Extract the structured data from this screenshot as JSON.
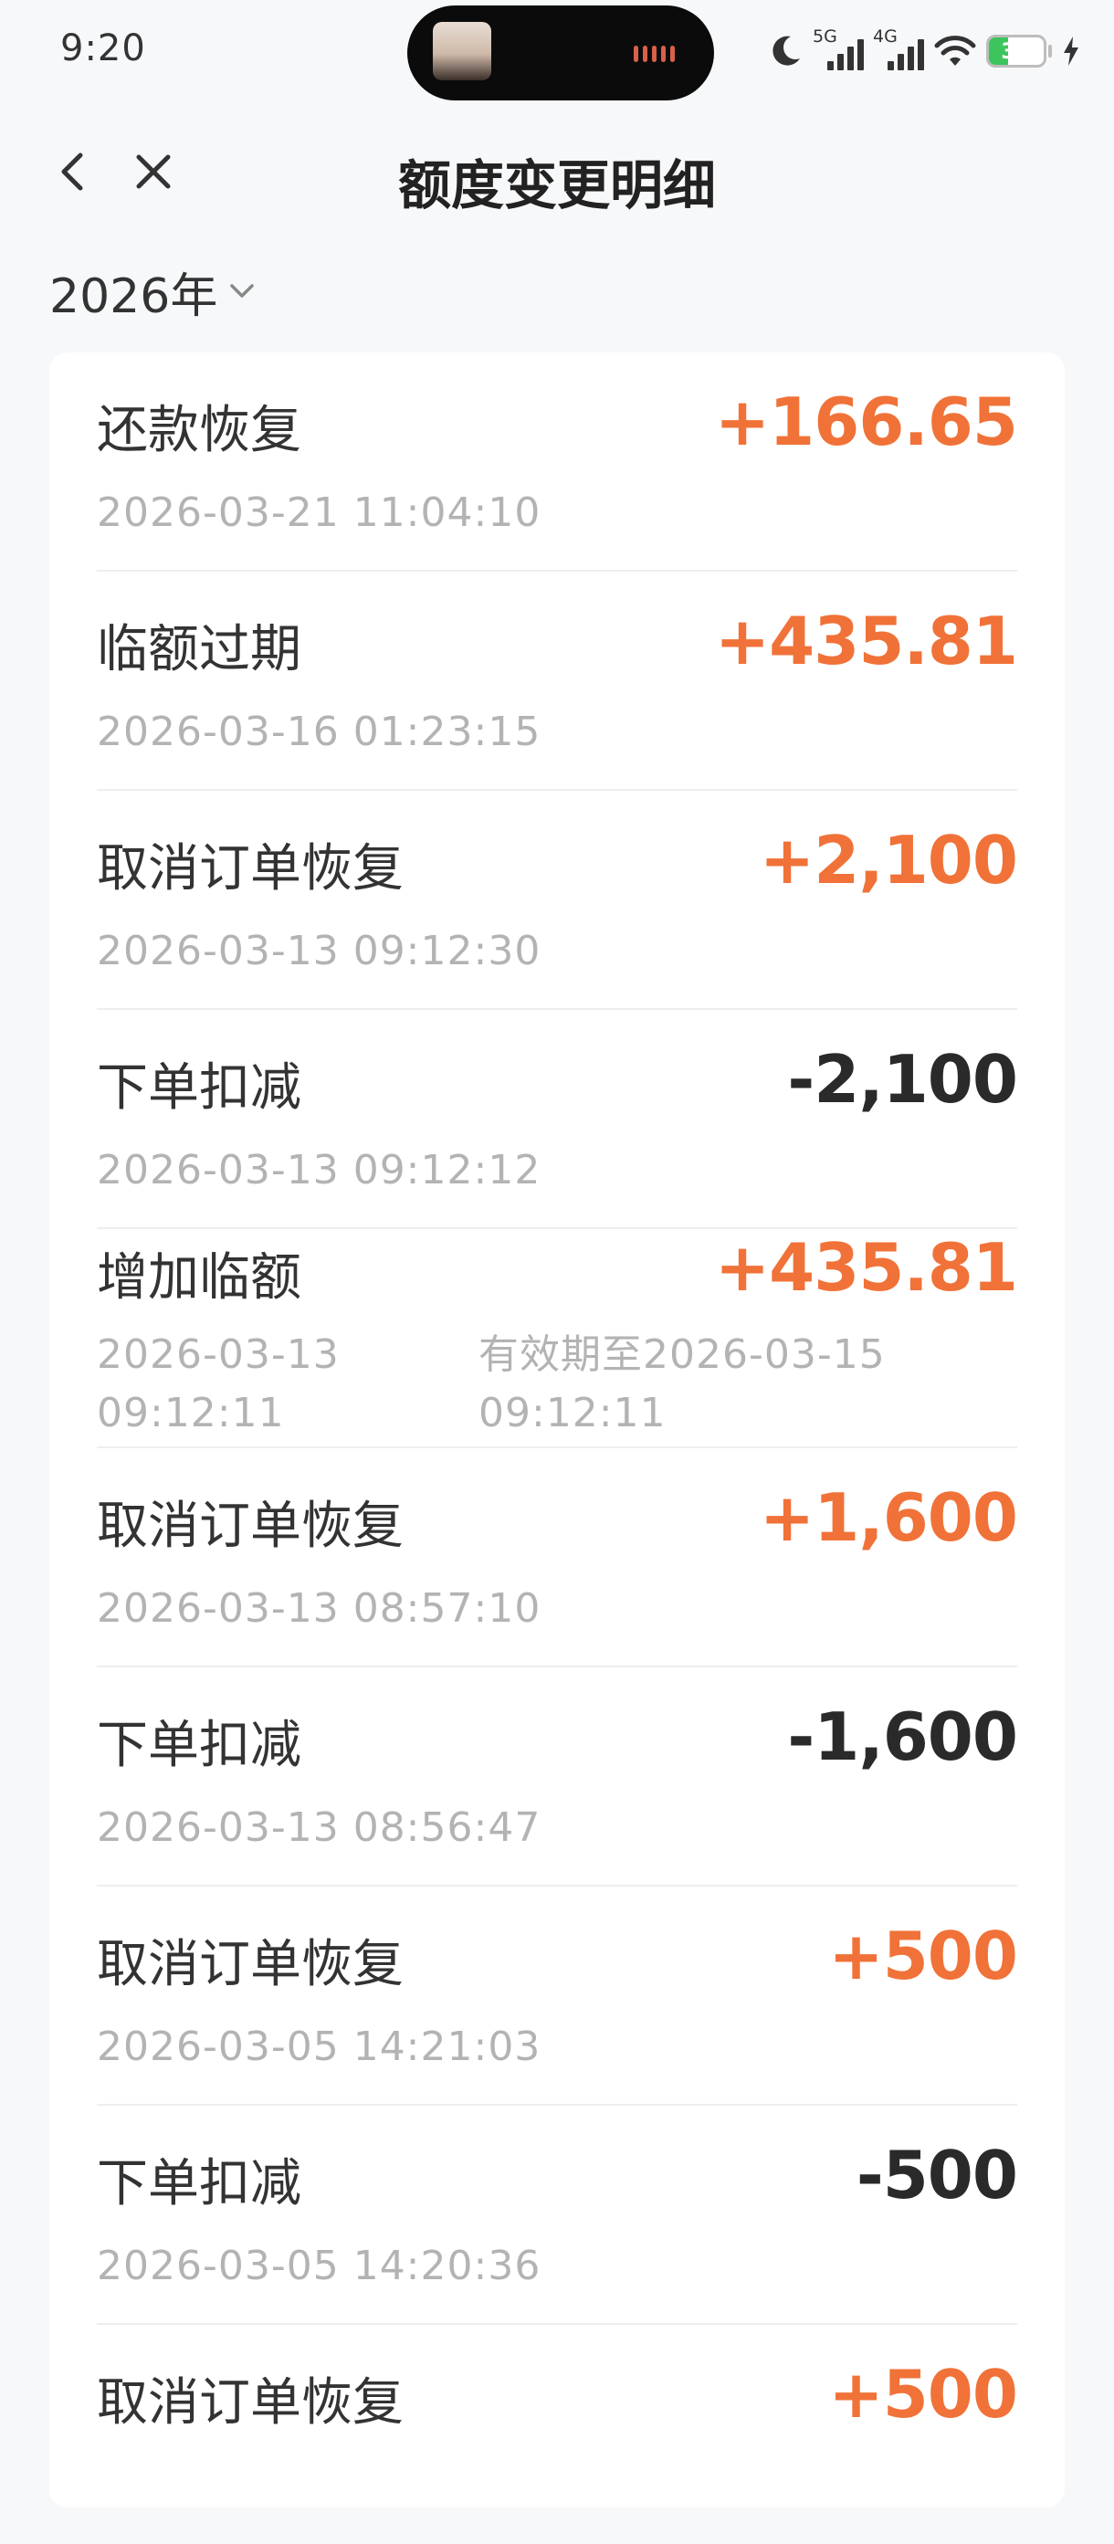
{
  "status_bar": {
    "time": "9:20",
    "signal1_label": "5G",
    "signal2_label": "4G",
    "battery_level": "35",
    "battery_percent": 35,
    "battery_color": "#3ec45c"
  },
  "nav": {
    "title": "额度变更明细",
    "back_icon": "chevron-left-icon",
    "close_icon": "close-icon"
  },
  "filter": {
    "year": "2026年"
  },
  "colors": {
    "positive": "#f07238",
    "negative": "#2a2a2a",
    "muted": "#b3b3b3"
  },
  "records": [
    {
      "title": "还款恢复",
      "amount": "+166.65",
      "sign": "pos",
      "time": "2026-03-21 11:04:10"
    },
    {
      "title": "临额过期",
      "amount": "+435.81",
      "sign": "pos",
      "time": "2026-03-16 01:23:15"
    },
    {
      "title": "取消订单恢复",
      "amount": "+2,100",
      "sign": "pos",
      "time": "2026-03-13 09:12:30"
    },
    {
      "title": "下单扣减",
      "amount": "-2,100",
      "sign": "neg",
      "time": "2026-03-13 09:12:12"
    },
    {
      "title": "增加临额",
      "amount": "+435.81",
      "sign": "pos",
      "time_line1": "2026-03-13",
      "time_line2": "09:12:11",
      "note_line1": "有效期至2026-03-15",
      "note_line2": "09:12:11"
    },
    {
      "title": "取消订单恢复",
      "amount": "+1,600",
      "sign": "pos",
      "time": "2026-03-13 08:57:10"
    },
    {
      "title": "下单扣减",
      "amount": "-1,600",
      "sign": "neg",
      "time": "2026-03-13 08:56:47"
    },
    {
      "title": "取消订单恢复",
      "amount": "+500",
      "sign": "pos",
      "time": "2026-03-05 14:21:03"
    },
    {
      "title": "下单扣减",
      "amount": "-500",
      "sign": "neg",
      "time": "2026-03-05 14:20:36"
    },
    {
      "title": "取消订单恢复",
      "amount": "+500",
      "sign": "pos",
      "time": ""
    }
  ]
}
